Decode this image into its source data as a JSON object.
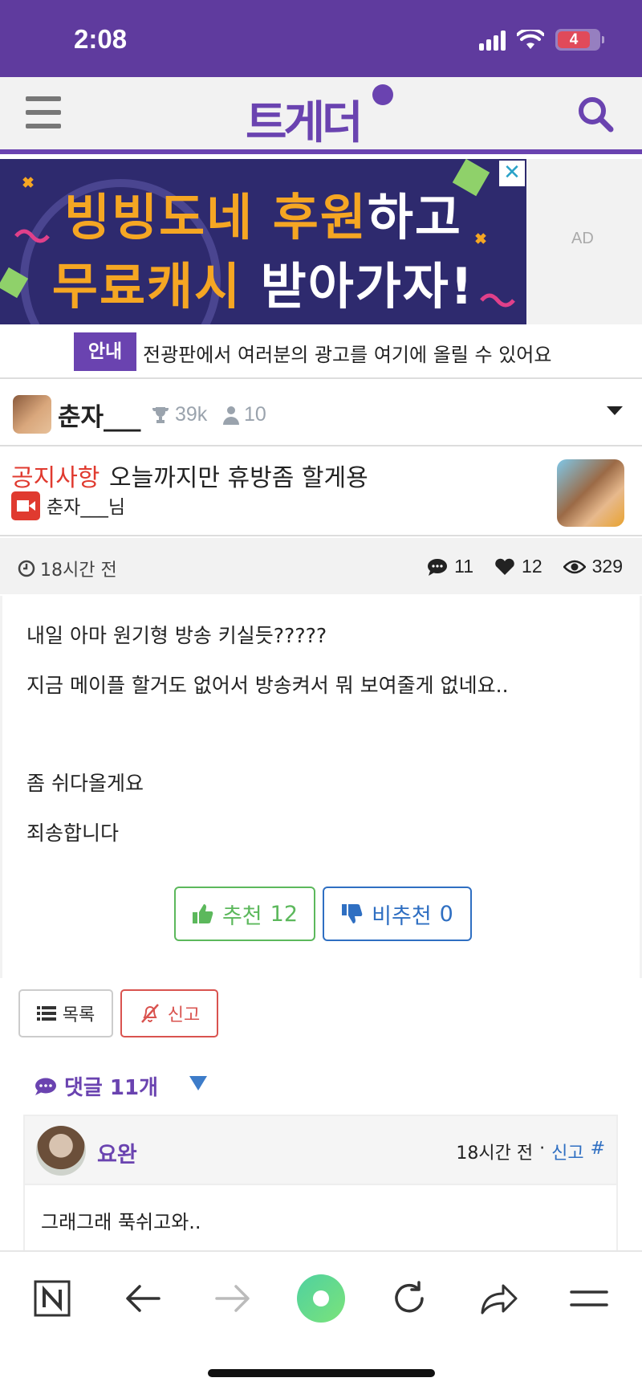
{
  "status_bar": {
    "time": "2:08",
    "battery": "4"
  },
  "header": {
    "logo": "트게더"
  },
  "ad": {
    "line1": [
      {
        "text": "빙빙도네 후원",
        "style": "o"
      },
      {
        "text": "하고",
        "style": "w"
      }
    ],
    "line1_a": "빙빙도네 후원",
    "line1_b": "하고",
    "line2_a": "무료캐시 ",
    "line2_b": "받아가자!",
    "close": "✕",
    "label": "AD"
  },
  "notice": {
    "badge": "안내",
    "text": "전광판에서 여러분의 광고를 여기에 올릴 수 있어요"
  },
  "channel": {
    "name": "춘자___",
    "trophy_count": "39k",
    "member_count": "10"
  },
  "post": {
    "category": "공지사항",
    "title": "오늘까지만 휴방좀 할게용",
    "author": "춘자___님",
    "time": "18시간 전",
    "comments": "11",
    "likes": "12",
    "views": "329",
    "body": [
      "내일 아마 원기형 방송 키실듯?????",
      "지금 메이플 할거도 없어서 방송켜서 뭐 보여줄게 없네요..",
      "좀 쉬다올게요",
      "죄송합니다"
    ]
  },
  "votes": {
    "up_label": "추천",
    "up_count": "12",
    "down_label": "비추천",
    "down_count": "0"
  },
  "actions": {
    "list_label": "목록",
    "report_label": "신고"
  },
  "comments_section": {
    "header": "댓글 11개",
    "items": [
      {
        "author": "요완",
        "time": "18시간 전",
        "separator": "·",
        "report": "신고",
        "anchor": "#",
        "text": "그래그래 푹쉬고와.."
      }
    ]
  },
  "colors": {
    "brand": "#6a43b0",
    "status_bar": "#5f3b9e",
    "upvote": "#5cb85c",
    "downvote": "#2f6fc2",
    "report": "#d9534f",
    "category": "#e03a2f"
  }
}
